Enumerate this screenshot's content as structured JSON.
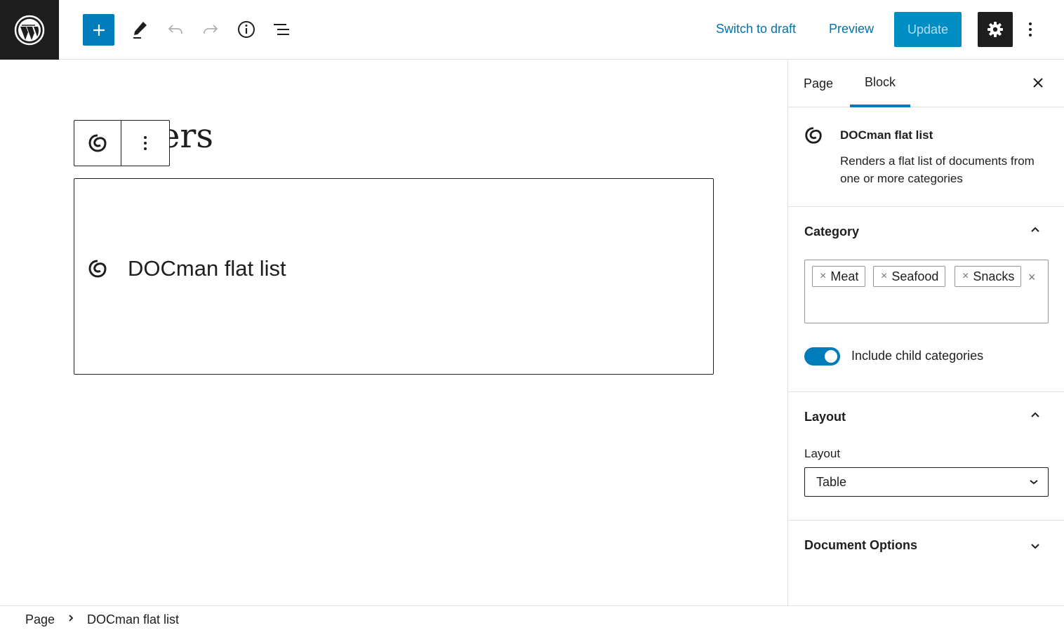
{
  "toolbar": {
    "switch_to_draft": "Switch to draft",
    "preview": "Preview",
    "update": "Update"
  },
  "editor": {
    "heading_visible": "ers",
    "block_placeholder_title": "DOCman flat list"
  },
  "sidebar": {
    "tabs": [
      {
        "label": "Page",
        "active": false
      },
      {
        "label": "Block",
        "active": true
      }
    ],
    "block_card": {
      "title": "DOCman flat list",
      "description": "Renders a flat list of documents from one or more categories"
    },
    "category_panel": {
      "title": "Category",
      "tokens": [
        "Meat",
        "Seafood",
        "Snacks"
      ],
      "include_children_label": "Include child categories",
      "include_children_enabled": true
    },
    "layout_panel": {
      "title": "Layout",
      "field_label": "Layout",
      "selected": "Table"
    },
    "document_options_panel": {
      "title": "Document Options"
    }
  },
  "breadcrumb": {
    "items": [
      "Page",
      "DOCman flat list"
    ]
  },
  "colors": {
    "accent": "#007cba",
    "link": "#0073aa",
    "dark": "#1e1e1e",
    "border": "#e0e0e0"
  },
  "icons": [
    "wordpress-logo-icon",
    "plus-icon",
    "pencil-icon",
    "undo-icon",
    "redo-icon",
    "info-icon",
    "list-view-icon",
    "gear-icon",
    "vertical-dots-icon",
    "close-icon",
    "docman-icon",
    "chevron-up-icon",
    "chevron-down-icon",
    "chevron-right-icon"
  ]
}
